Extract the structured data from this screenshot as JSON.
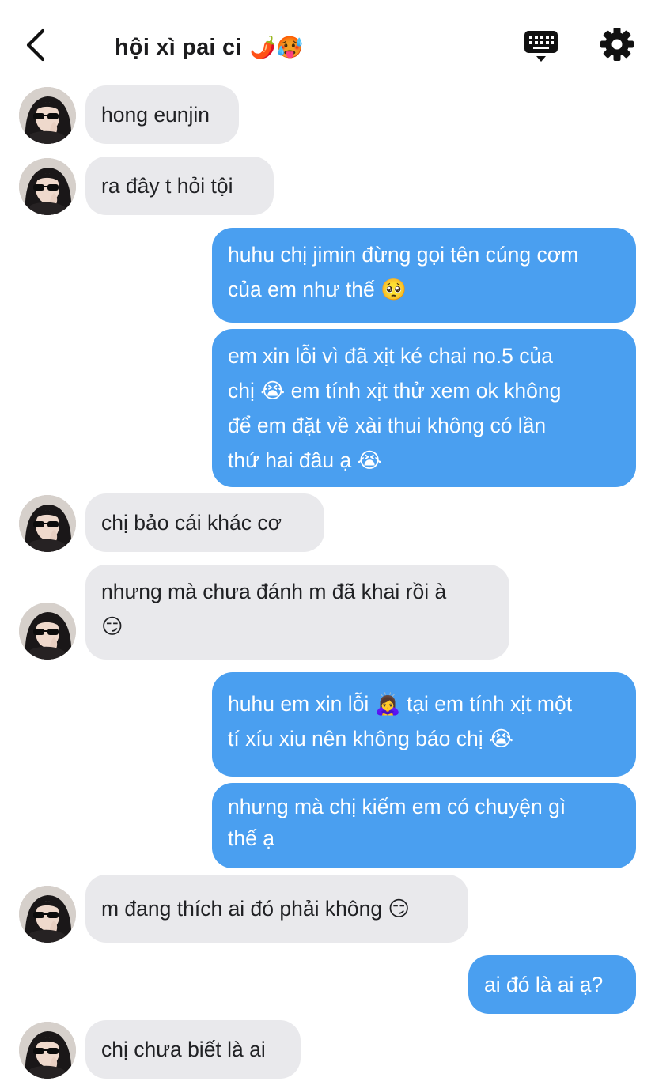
{
  "header": {
    "title": "hội xì pai ci",
    "title_emojis": "🌶️🥵",
    "back_icon": "chevron-left-icon",
    "keyboard_icon": "keyboard-icon",
    "settings_icon": "gear-icon"
  },
  "colors": {
    "outgoing_bubble": "#4a9ff0",
    "incoming_bubble": "#e9e9ec",
    "outgoing_text": "#ffffff",
    "incoming_text": "#202124"
  },
  "messages": [
    {
      "side": "in",
      "text": "hong eunjin"
    },
    {
      "side": "in",
      "text": "ra đây t hỏi tội"
    },
    {
      "side": "out",
      "text": "huhu chị jimin đừng gọi tên cúng cơm\ncủa em như thế 🥺"
    },
    {
      "side": "out",
      "text": "em xin lỗi vì đã xịt ké chai no.5 của\nchị 😭 em tính xịt thử xem ok không\nđể em đặt về xài thui không có lần\nthứ hai đâu ạ 😭"
    },
    {
      "side": "in",
      "text": "chị bảo cái khác cơ"
    },
    {
      "side": "in",
      "text": "nhưng mà chưa đánh m đã khai rồi à\n😏"
    },
    {
      "side": "out",
      "text": "huhu em xin lỗi 🙇‍♀️ tại em tính xịt một\ntí xíu xiu nên không báo chị 😭"
    },
    {
      "side": "out",
      "text": "nhưng mà chị kiếm em có chuyện gì\nthế ạ"
    },
    {
      "side": "in",
      "text": "m đang thích ai đó phải không 😏"
    },
    {
      "side": "out",
      "text": "ai đó là ai ạ?"
    },
    {
      "side": "in",
      "text": "chị chưa biết là ai"
    }
  ]
}
